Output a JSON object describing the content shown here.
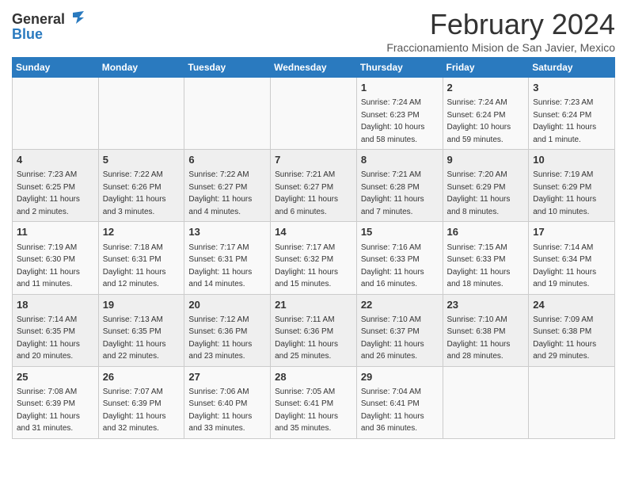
{
  "header": {
    "logo_general": "General",
    "logo_blue": "Blue",
    "title": "February 2024",
    "subtitle": "Fraccionamiento Mision de San Javier, Mexico"
  },
  "weekdays": [
    "Sunday",
    "Monday",
    "Tuesday",
    "Wednesday",
    "Thursday",
    "Friday",
    "Saturday"
  ],
  "weeks": [
    [
      {
        "day": "",
        "info": ""
      },
      {
        "day": "",
        "info": ""
      },
      {
        "day": "",
        "info": ""
      },
      {
        "day": "",
        "info": ""
      },
      {
        "day": "1",
        "info": "Sunrise: 7:24 AM\nSunset: 6:23 PM\nDaylight: 10 hours\nand 58 minutes."
      },
      {
        "day": "2",
        "info": "Sunrise: 7:24 AM\nSunset: 6:24 PM\nDaylight: 10 hours\nand 59 minutes."
      },
      {
        "day": "3",
        "info": "Sunrise: 7:23 AM\nSunset: 6:24 PM\nDaylight: 11 hours\nand 1 minute."
      }
    ],
    [
      {
        "day": "4",
        "info": "Sunrise: 7:23 AM\nSunset: 6:25 PM\nDaylight: 11 hours\nand 2 minutes."
      },
      {
        "day": "5",
        "info": "Sunrise: 7:22 AM\nSunset: 6:26 PM\nDaylight: 11 hours\nand 3 minutes."
      },
      {
        "day": "6",
        "info": "Sunrise: 7:22 AM\nSunset: 6:27 PM\nDaylight: 11 hours\nand 4 minutes."
      },
      {
        "day": "7",
        "info": "Sunrise: 7:21 AM\nSunset: 6:27 PM\nDaylight: 11 hours\nand 6 minutes."
      },
      {
        "day": "8",
        "info": "Sunrise: 7:21 AM\nSunset: 6:28 PM\nDaylight: 11 hours\nand 7 minutes."
      },
      {
        "day": "9",
        "info": "Sunrise: 7:20 AM\nSunset: 6:29 PM\nDaylight: 11 hours\nand 8 minutes."
      },
      {
        "day": "10",
        "info": "Sunrise: 7:19 AM\nSunset: 6:29 PM\nDaylight: 11 hours\nand 10 minutes."
      }
    ],
    [
      {
        "day": "11",
        "info": "Sunrise: 7:19 AM\nSunset: 6:30 PM\nDaylight: 11 hours\nand 11 minutes."
      },
      {
        "day": "12",
        "info": "Sunrise: 7:18 AM\nSunset: 6:31 PM\nDaylight: 11 hours\nand 12 minutes."
      },
      {
        "day": "13",
        "info": "Sunrise: 7:17 AM\nSunset: 6:31 PM\nDaylight: 11 hours\nand 14 minutes."
      },
      {
        "day": "14",
        "info": "Sunrise: 7:17 AM\nSunset: 6:32 PM\nDaylight: 11 hours\nand 15 minutes."
      },
      {
        "day": "15",
        "info": "Sunrise: 7:16 AM\nSunset: 6:33 PM\nDaylight: 11 hours\nand 16 minutes."
      },
      {
        "day": "16",
        "info": "Sunrise: 7:15 AM\nSunset: 6:33 PM\nDaylight: 11 hours\nand 18 minutes."
      },
      {
        "day": "17",
        "info": "Sunrise: 7:14 AM\nSunset: 6:34 PM\nDaylight: 11 hours\nand 19 minutes."
      }
    ],
    [
      {
        "day": "18",
        "info": "Sunrise: 7:14 AM\nSunset: 6:35 PM\nDaylight: 11 hours\nand 20 minutes."
      },
      {
        "day": "19",
        "info": "Sunrise: 7:13 AM\nSunset: 6:35 PM\nDaylight: 11 hours\nand 22 minutes."
      },
      {
        "day": "20",
        "info": "Sunrise: 7:12 AM\nSunset: 6:36 PM\nDaylight: 11 hours\nand 23 minutes."
      },
      {
        "day": "21",
        "info": "Sunrise: 7:11 AM\nSunset: 6:36 PM\nDaylight: 11 hours\nand 25 minutes."
      },
      {
        "day": "22",
        "info": "Sunrise: 7:10 AM\nSunset: 6:37 PM\nDaylight: 11 hours\nand 26 minutes."
      },
      {
        "day": "23",
        "info": "Sunrise: 7:10 AM\nSunset: 6:38 PM\nDaylight: 11 hours\nand 28 minutes."
      },
      {
        "day": "24",
        "info": "Sunrise: 7:09 AM\nSunset: 6:38 PM\nDaylight: 11 hours\nand 29 minutes."
      }
    ],
    [
      {
        "day": "25",
        "info": "Sunrise: 7:08 AM\nSunset: 6:39 PM\nDaylight: 11 hours\nand 31 minutes."
      },
      {
        "day": "26",
        "info": "Sunrise: 7:07 AM\nSunset: 6:39 PM\nDaylight: 11 hours\nand 32 minutes."
      },
      {
        "day": "27",
        "info": "Sunrise: 7:06 AM\nSunset: 6:40 PM\nDaylight: 11 hours\nand 33 minutes."
      },
      {
        "day": "28",
        "info": "Sunrise: 7:05 AM\nSunset: 6:41 PM\nDaylight: 11 hours\nand 35 minutes."
      },
      {
        "day": "29",
        "info": "Sunrise: 7:04 AM\nSunset: 6:41 PM\nDaylight: 11 hours\nand 36 minutes."
      },
      {
        "day": "",
        "info": ""
      },
      {
        "day": "",
        "info": ""
      }
    ]
  ]
}
